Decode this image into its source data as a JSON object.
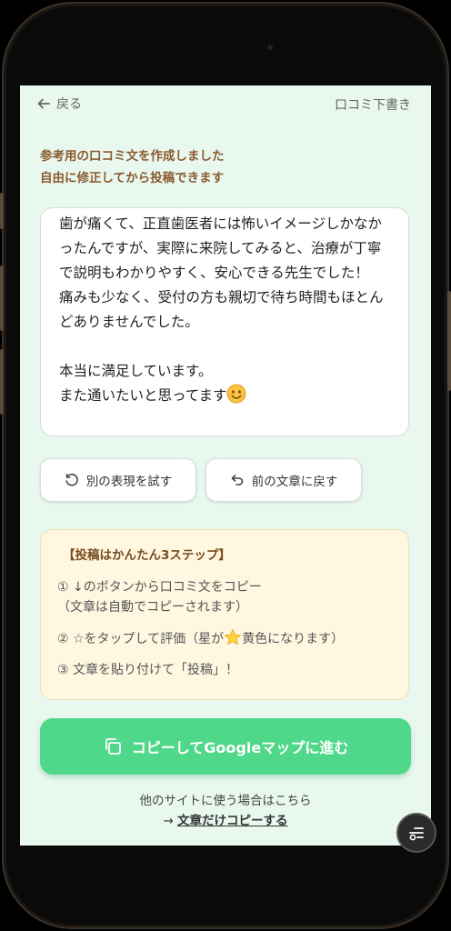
{
  "header": {
    "back_label": "戻る",
    "right_title": "口コミ下書き"
  },
  "notice": {
    "line1": "参考用の口コミ文を作成しました",
    "line2": "自由に修正してから投稿できます"
  },
  "review": {
    "text": "歯が痛くて、正直歯医者には怖いイメージしかなかったんですが、実際に来院してみると、治療が丁寧で説明もわかりやすく、安心できる先生でした！\n痛みも少なく、受付の方も親切で待ち時間もほとんどありませんでした。\n\n本当に満足しています。\nまた通いたいと思ってます"
  },
  "actions": {
    "retry_label": "別の表現を試す",
    "revert_label": "前の文章に戻す"
  },
  "steps": {
    "title": "【投稿はかんたん3ステップ】",
    "step1": "① ↓のボタンから口コミ文をコピー",
    "step1_note": "（文章は自動でコピーされます）",
    "step2_before": "② ☆をタップして評価（星が",
    "step2_after": "黄色になります）",
    "step3": "③ 文章を貼り付けて「投稿」！"
  },
  "cta": {
    "label": "コピーしてGoogleマップに進む"
  },
  "footer": {
    "other_sites": "他のサイトに使う場合はこちら",
    "arrow": "→ ",
    "copy_only_label": "文章だけコピーする"
  },
  "colors": {
    "background": "#e8f8ef",
    "accent_green": "#4fd88a",
    "notice_brown": "#8a5a2e",
    "steps_bg": "#fff7e0"
  },
  "icons": {
    "back": "arrow-left-icon",
    "retry": "rotate-ccw-icon",
    "revert": "undo-icon",
    "copy": "copy-icon",
    "fab": "menu-toggle-icon"
  }
}
